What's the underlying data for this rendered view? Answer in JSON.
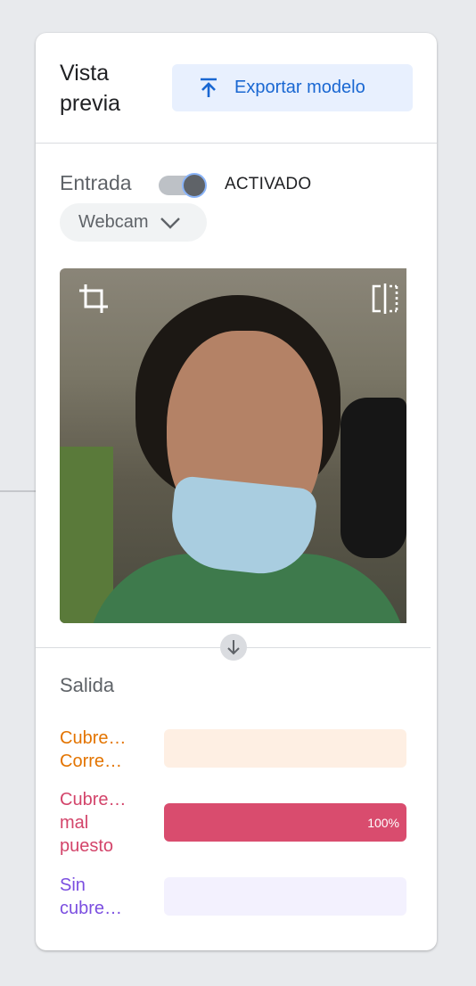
{
  "header": {
    "title": "Vista previa",
    "export_label": "Exportar modelo"
  },
  "input": {
    "label": "Entrada",
    "toggle_state": "ACTIVADO",
    "toggle_on": true,
    "source": "Webcam"
  },
  "output": {
    "title": "Salida",
    "classes": [
      {
        "label_lines": [
          "Cubre…",
          "Corre…"
        ],
        "percent_value": 0,
        "percent_text": "",
        "text_color": "#e37400",
        "track_color": "#feefe3",
        "fill_color": "#e37400"
      },
      {
        "label_lines": [
          "Cubre…",
          "mal",
          "puesto"
        ],
        "percent_value": 100,
        "percent_text": "100%",
        "text_color": "#d3446a",
        "track_color": "#fce8ee",
        "fill_color": "#d94c6e"
      },
      {
        "label_lines": [
          "Sin",
          "cubre…"
        ],
        "percent_value": 0,
        "percent_text": "",
        "text_color": "#7b4ee0",
        "track_color": "#f3f1fe",
        "fill_color": "#7b4ee0"
      }
    ]
  },
  "icons": {
    "export": "upload-icon",
    "crop": "crop-icon",
    "flip": "flip-icon",
    "dropdown": "chevron-down-icon",
    "down": "arrow-down-icon"
  }
}
